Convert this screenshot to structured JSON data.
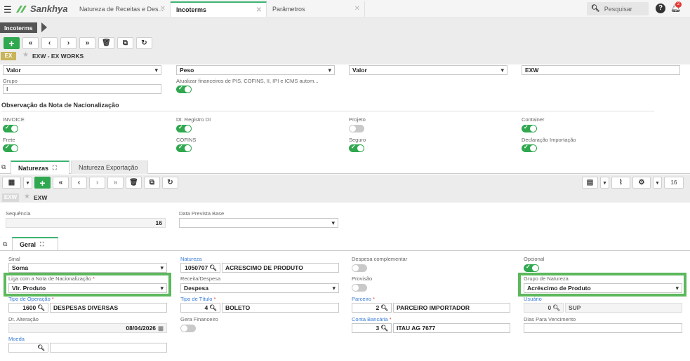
{
  "app": {
    "brand": "Sankhya",
    "tabs": [
      {
        "label": "Natureza de Receitas e Des..."
      },
      {
        "label": "Incoterms"
      },
      {
        "label": "Parâmetros"
      }
    ],
    "search_placeholder": "Pesquisar",
    "notif_count": "2"
  },
  "header": {
    "breadcrumb": "Incoterms",
    "badge": "EX",
    "record_title": "EXW - EX WORKS"
  },
  "top_form": {
    "row1": [
      "Valor",
      "Peso",
      "Valor",
      "EXW"
    ],
    "grupo_label": "Grupo",
    "grupo_value": "I",
    "atualizar_label": "Atualizar financeiros de PIS, COFINS, II, IPI e ICMS autom...",
    "obs_title": "Observação da Nota de Nacionalização",
    "toggles": [
      {
        "label": "INVOICE",
        "on": true
      },
      {
        "label": "Dt. Registro DI",
        "on": true
      },
      {
        "label": "Projeto",
        "on": false
      },
      {
        "label": "Container",
        "on": true
      },
      {
        "label": "Frete",
        "on": true
      },
      {
        "label": "COFINS",
        "on": true
      },
      {
        "label": "Seguro",
        "on": true
      },
      {
        "label": "Declaração Importação",
        "on": true
      }
    ]
  },
  "subtabs": [
    {
      "label": "Naturezas"
    },
    {
      "label": "Natureza Exportação"
    }
  ],
  "grid_toolbar": {
    "page_size": "16"
  },
  "detail": {
    "badge": "EXW",
    "title": "EXW"
  },
  "detail_form": {
    "sequencia_label": "Sequência",
    "sequencia_value": "16",
    "data_prevista_label": "Data Prevista Base",
    "data_prevista_value": "",
    "geral_tab": "Geral",
    "sinal_label": "Sinal",
    "sinal_value": "Soma",
    "natureza_label": "Natureza",
    "natureza_code": "1050707",
    "natureza_desc": "ACRESCIMO DE PRODUTO",
    "despesa_compl_label": "Despesa complementar",
    "opcional_label": "Opcional",
    "liga_label": "Liga com a Nota de Nacionalização",
    "liga_value": "Vlr. Produto",
    "receita_label": "Receita/Despesa",
    "receita_value": "Despesa",
    "provisao_label": "Provisão",
    "grupo_nat_label": "Grupo de Natureza",
    "grupo_nat_value": "Acréscimo de Produto",
    "tipo_op_label": "Tipo de Operação",
    "tipo_op_code": "1600",
    "tipo_op_desc": "DESPESAS DIVERSAS",
    "tipo_tit_label": "Tipo de Título",
    "tipo_tit_code": "4",
    "tipo_tit_desc": "BOLETO",
    "parceiro_label": "Parceiro",
    "parceiro_code": "2",
    "parceiro_desc": "PARCEIRO IMPORTADOR",
    "usuario_label": "Usuário",
    "usuario_code": "0",
    "usuario_desc": "SUP",
    "dt_alt_label": "Dt. Alteração",
    "dt_alt_value": "08/04/2026",
    "gera_fin_label": "Gera Financeiro",
    "conta_label": "Conta Bancária",
    "conta_code": "3",
    "conta_desc": "ITAU AG 7677",
    "dias_label": "Dias Para Vencimento",
    "moeda_label": "Moeda"
  },
  "colors": {
    "accent": "#2fa84f",
    "highlight": "#5cb85c",
    "brand": "#5cb85c"
  }
}
